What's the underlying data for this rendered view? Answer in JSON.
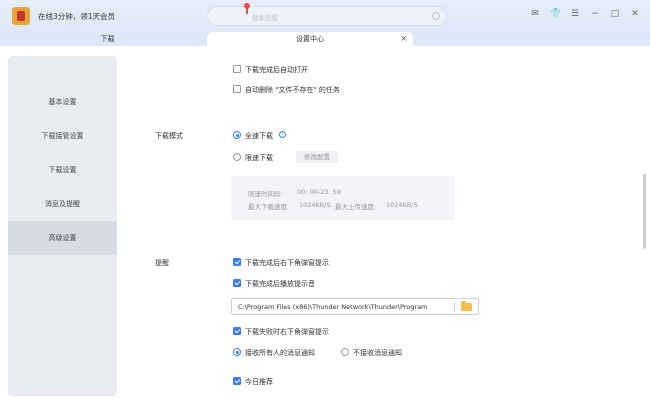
{
  "header": {
    "promo_text": "在线3分钟，领1天会员",
    "search_placeholder": "搜索迅雷",
    "window_controls": [
      "mail-icon",
      "shirt-icon",
      "menu-icon",
      "minimize-icon",
      "maximize-icon",
      "close-icon"
    ]
  },
  "tabs": {
    "download": "下载",
    "settings": "设置中心",
    "close_symbol": "×"
  },
  "sidebar": {
    "items": [
      {
        "label": "基本设置"
      },
      {
        "label": "下载接管设置"
      },
      {
        "label": "下载设置"
      },
      {
        "label": "消息及提醒"
      },
      {
        "label": "高级设置",
        "active": true
      }
    ]
  },
  "content": {
    "opt_auto_open": "下载完成后自动打开",
    "opt_auto_delete": "自动删除 \"文件不存在\" 的任务",
    "download_mode_label": "下载模式",
    "mode_full_speed": "全速下载",
    "mode_limited": "限速下载",
    "modify_config": "修改配置",
    "schedule": {
      "time_label": "限速时间段:",
      "time_value": "00: 00-23: 59",
      "max_down_label": "最大下载速度:",
      "max_down_value": "1024KB/S",
      "max_up_label": "最大上传速度:",
      "max_up_value": "1024KB/S"
    },
    "remind_label": "提醒",
    "remind_popup": "下载完成后右下角弹窗提示",
    "remind_sound": "下载完成后播放提示音",
    "sound_path": "C:\\Program Files (x86)\\Thunder Network\\Thunder\\Program",
    "fail_popup": "下载失败时右下角弹窗提示",
    "receive_all": "接收所有人的消息通知",
    "receive_none": "不接收消息通知",
    "today_recommend": "今日推荐"
  },
  "colors": {
    "accent": "#3b7cf5",
    "titlebar": "#dfe8f8",
    "sidebar": "#e8ebf0"
  }
}
